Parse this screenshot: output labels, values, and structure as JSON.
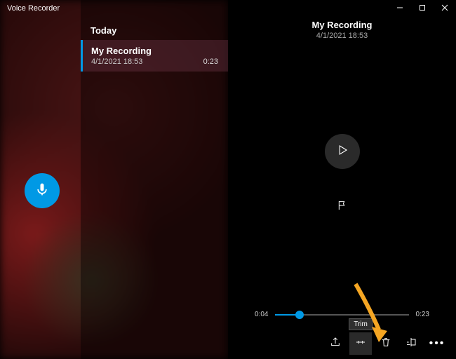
{
  "app": {
    "title": "Voice Recorder"
  },
  "list": {
    "header": "Today",
    "item": {
      "title": "My Recording",
      "datetime": "4/1/2021 18:53",
      "duration": "0:23"
    }
  },
  "detail": {
    "title": "My Recording",
    "datetime": "4/1/2021 18:53"
  },
  "timeline": {
    "current": "0:04",
    "total": "0:23"
  },
  "tooltip": {
    "trim": "Trim"
  },
  "icons": {
    "mic": "mic-icon",
    "play": "play-icon",
    "flag": "flag-icon",
    "share": "share-icon",
    "trim": "trim-icon",
    "delete": "delete-icon",
    "rename": "rename-icon",
    "more": "more-icon",
    "minimize": "minimize-icon",
    "maximize": "maximize-icon",
    "close": "close-icon"
  },
  "colors": {
    "accent": "#0099e5",
    "annotation": "#f5a623"
  }
}
